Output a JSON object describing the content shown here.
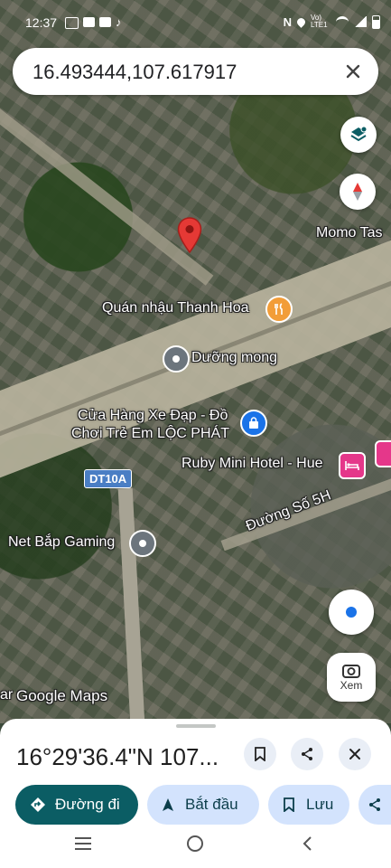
{
  "status_bar": {
    "time": "12:37",
    "network_label": "Vo) LTE1"
  },
  "search": {
    "value": "16.493444,107.617917",
    "placeholder": ""
  },
  "map": {
    "labels": {
      "momo": "Momo Tas",
      "quan_nhau": "Quán nhậu Thanh Hoa",
      "duong_mong": "Dưỡng mong",
      "cua_hang_line1": "Cửa Hàng Xe Đạp - Đồ",
      "cua_hang_line2": "Chơi Trẻ Em LỘC PHÁT",
      "ruby": "Ruby Mini Hotel - Hue",
      "road_dt10a": "DT10A",
      "net_bap": "Net Bắp Gaming",
      "duong_so": "Đường Số 5H",
      "left_edge": "ar",
      "watermark": "Google Maps"
    },
    "lens_label": "Xem"
  },
  "sheet": {
    "coordinates": "16°29'36.4\"N 107...",
    "directions_label": "Đường đi",
    "start_label": "Bắt đầu",
    "save_label": "Lưu"
  },
  "colors": {
    "accent_teal": "#0b5d64",
    "chip_bg": "#d3e3fd",
    "pin_red": "#e53935",
    "restaurant_orange": "#f29d38",
    "shop_blue": "#1a73e8",
    "hotel_pink": "#e5378a",
    "my_location_blue": "#1a73e8"
  }
}
